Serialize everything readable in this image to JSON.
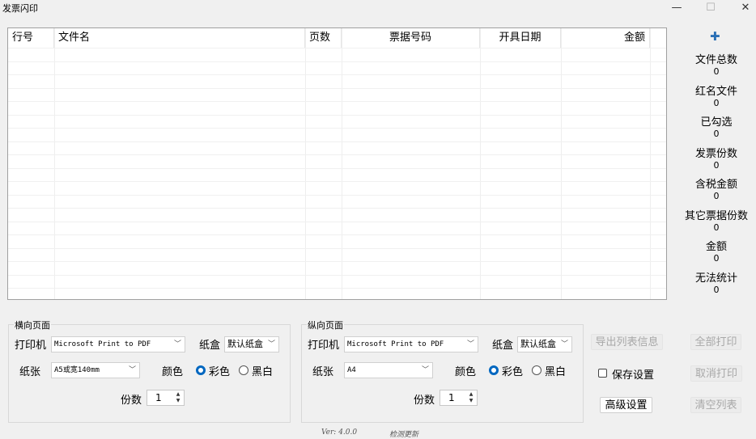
{
  "window": {
    "title": "发票闪印",
    "minimize": "—",
    "maximize": "☐",
    "close": "✕"
  },
  "table": {
    "columns": [
      "行号",
      "文件名",
      "页数",
      "票据号码",
      "开具日期",
      "金额"
    ]
  },
  "stats": [
    {
      "label": "文件总数",
      "value": "0"
    },
    {
      "label": "红名文件",
      "value": "0"
    },
    {
      "label": "已勾选",
      "value": "0"
    },
    {
      "label": "发票份数",
      "value": "0"
    },
    {
      "label": "含税金额",
      "value": "0"
    },
    {
      "label": "其它票据份数",
      "value": "0"
    },
    {
      "label": "金额",
      "value": "0"
    },
    {
      "label": "无法统计",
      "value": "0"
    }
  ],
  "landscape": {
    "title": "横向页面",
    "printer_label": "打印机",
    "printer": "Microsoft Print to PDF",
    "tray_label": "纸盒",
    "tray": "默认纸盒",
    "paper_label": "纸张",
    "paper": "A5或宽140mm",
    "color_label": "颜色",
    "color_option": "彩色",
    "bw_option": "黑白",
    "copies_label": "份数",
    "copies": "1"
  },
  "portrait": {
    "title": "纵向页面",
    "printer_label": "打印机",
    "printer": "Microsoft Print to PDF",
    "tray_label": "纸盒",
    "tray": "默认纸盒",
    "paper_label": "纸张",
    "paper": "A4",
    "color_label": "颜色",
    "color_option": "彩色",
    "bw_option": "黑白",
    "copies_label": "份数",
    "copies": "1"
  },
  "buttons": {
    "export": "导出列表信息",
    "print_all": "全部打印",
    "save_settings": "保存设置",
    "cancel_print": "取消打印",
    "advanced": "高级设置",
    "clear_list": "清空列表"
  },
  "footer": {
    "version": "Ver: 4.0.0",
    "check_update": "检测更新"
  }
}
